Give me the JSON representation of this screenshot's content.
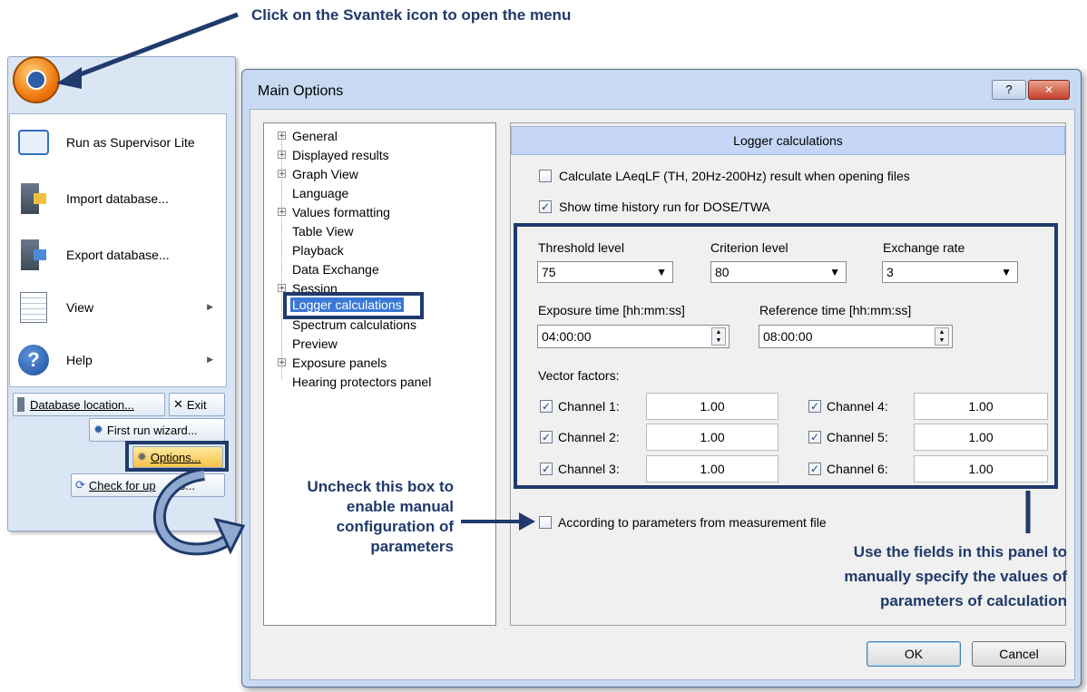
{
  "callouts": {
    "top": "Click on the Svantek icon to open the menu",
    "uncheck": [
      "Uncheck this box to",
      "enable manual",
      "configuration of",
      "parameters"
    ],
    "panel": [
      "Use the fields in this panel to",
      "manually specify the values of",
      "parameters of calculation"
    ]
  },
  "app_menu": {
    "items": [
      {
        "label": "Run as Supervisor Lite",
        "icon": "monitor-icon"
      },
      {
        "label": "Import database...",
        "icon": "import-database-icon"
      },
      {
        "label": "Export database...",
        "icon": "export-database-icon"
      },
      {
        "label": "View",
        "icon": "view-icon"
      },
      {
        "label": "Help",
        "icon": "help-icon"
      }
    ],
    "database_location": "Database location...",
    "exit": "Exit",
    "first_run": "First run wizard...",
    "options": "Options...",
    "check_updates": "Check for up",
    "check_updates_tail": "s..."
  },
  "dialog": {
    "title": "Main Options",
    "help_button": "?",
    "close_button": "✕",
    "tree": [
      "General",
      "Displayed results",
      "Graph View",
      "Language",
      "Values formatting",
      "Table View",
      "Playback",
      "Data Exchange",
      "Session",
      "Logger calculations",
      "Spectrum calculations",
      "Preview",
      "Exposure panels",
      "Hearing protectors panel"
    ],
    "panel_title": "Logger calculations",
    "calc_laeq": "Calculate LAeqLF (TH, 20Hz-200Hz) result when opening files",
    "show_history": "Show time history run for DOSE/TWA",
    "threshold_label": "Threshold level",
    "threshold_value": "75",
    "criterion_label": "Criterion level",
    "criterion_value": "80",
    "exchange_label": "Exchange rate",
    "exchange_value": "3",
    "exposure_label": "Exposure time [hh:mm:ss]",
    "exposure_value": "04:00:00",
    "reference_label": "Reference time [hh:mm:ss]",
    "reference_value": "08:00:00",
    "vector_label": "Vector factors:",
    "channels": [
      {
        "label": "Channel 1:",
        "value": "1.00"
      },
      {
        "label": "Channel 2:",
        "value": "1.00"
      },
      {
        "label": "Channel 3:",
        "value": "1.00"
      },
      {
        "label": "Channel 4:",
        "value": "1.00"
      },
      {
        "label": "Channel 5:",
        "value": "1.00"
      },
      {
        "label": "Channel 6:",
        "value": "1.00"
      }
    ],
    "according": "According to parameters from measurement file",
    "ok": "OK",
    "cancel": "Cancel"
  },
  "colors": {
    "callout": "#1f3a6b",
    "panel_header": "#c6d6f7",
    "title_bar": "#c7daf1"
  }
}
